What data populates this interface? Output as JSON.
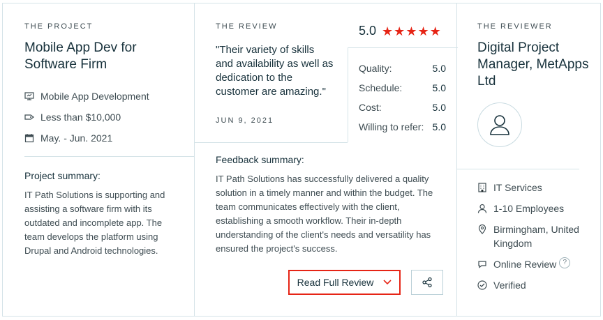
{
  "project": {
    "eyebrow": "THE PROJECT",
    "title": "Mobile App Dev for Software Firm",
    "meta": [
      {
        "icon": "monitor-icon",
        "text": "Mobile App Development"
      },
      {
        "icon": "price-tag-icon",
        "text": "Less than $10,000"
      },
      {
        "icon": "calendar-icon",
        "text": "May. - Jun. 2021"
      }
    ],
    "summary_heading": "Project summary:",
    "summary_text": "IT Path Solutions is supporting and assisting a software firm with its outdated and incomplete app. The team develops the platform using Drupal and Android technologies."
  },
  "review": {
    "eyebrow": "THE REVIEW",
    "quote": "\"Their variety of skills and availability as well as dedication to the customer are amazing.\"",
    "date": "JUN 9, 2021",
    "overall": "5.0",
    "stars": 5,
    "ratings": [
      {
        "label": "Quality:",
        "value": "5.0"
      },
      {
        "label": "Schedule:",
        "value": "5.0"
      },
      {
        "label": "Cost:",
        "value": "5.0"
      },
      {
        "label": "Willing to refer:",
        "value": "5.0"
      }
    ],
    "feedback_heading": "Feedback summary:",
    "feedback_text": "IT Path Solutions has successfully delivered a quality solution in a timely manner and within the budget. The team communicates effectively with the client, establishing a smooth workflow. Their in-depth understanding of the client's needs and versatility has ensured the project's success.",
    "read_button": "Read Full Review"
  },
  "reviewer": {
    "eyebrow": "THE REVIEWER",
    "title": "Digital Project Manager, MetApps Ltd",
    "details": [
      {
        "icon": "building-icon",
        "text": "IT Services"
      },
      {
        "icon": "person-icon",
        "text": "1-10 Employees"
      },
      {
        "icon": "location-pin-icon",
        "text": "Birmingham, United Kingdom"
      },
      {
        "icon": "speech-bubble-icon",
        "text": "Online Review"
      },
      {
        "icon": "verified-check-icon",
        "text": "Verified"
      }
    ],
    "help_glyph": "?"
  },
  "colors": {
    "accent": "#e62415",
    "text": "#17313b",
    "muted": "#3e4c52",
    "border": "#d5e3e8"
  }
}
